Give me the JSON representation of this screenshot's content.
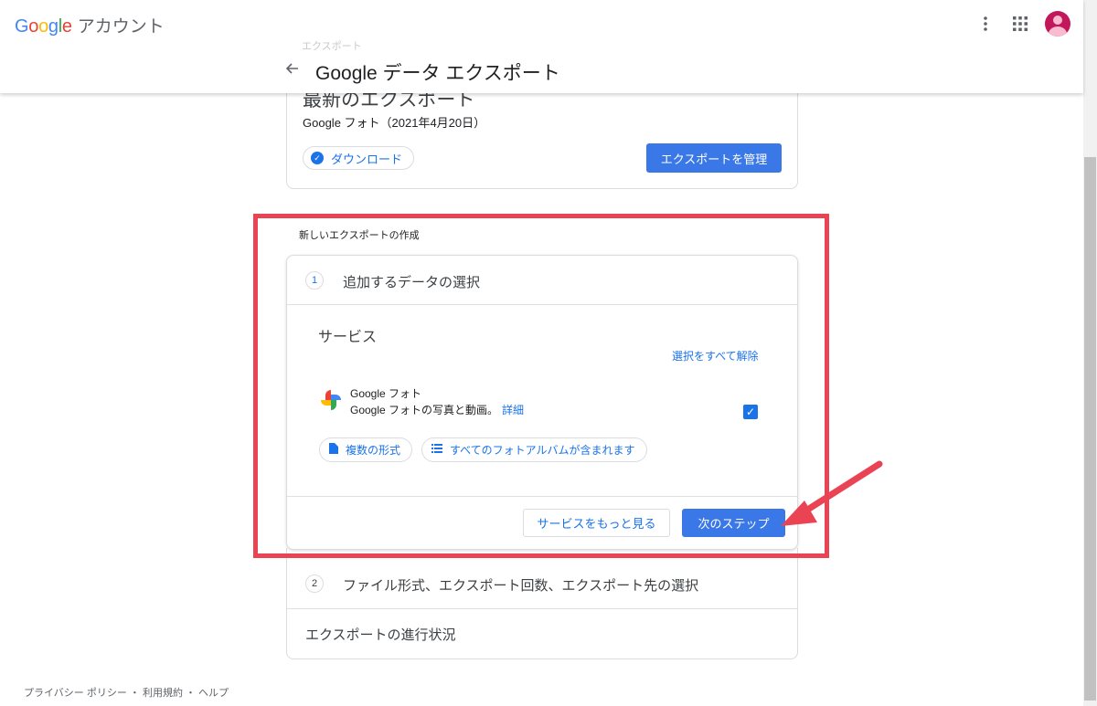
{
  "header": {
    "logo_word": "Google",
    "logo_suffix": "アカウント",
    "faded_label": "エクスポート",
    "page_title": "Google データ エクスポート",
    "icons": [
      "more-vert-icon",
      "apps-icon",
      "avatar",
      "arrow-back-icon"
    ]
  },
  "latest_export": {
    "heading": "最新のエクスポート",
    "meta": "Google フォト（2021年4月20日）",
    "download_label": "ダウンロード",
    "manage_button": "エクスポートを管理"
  },
  "new_export": {
    "section_label": "新しいエクスポートの作成",
    "step1": {
      "number": "1",
      "title": "追加するデータの選択",
      "services_heading": "サービス",
      "deselect_all": "選択をすべて解除",
      "service": {
        "name": "Google フォト",
        "description": "Google フォトの写真と動画。",
        "detail_link": "詳細",
        "checked": true,
        "format_chip": "複数の形式",
        "album_chip": "すべてのフォトアルバムが含まれます"
      },
      "more_services_button": "サービスをもっと見る",
      "next_step_button": "次のステップ"
    },
    "step2": {
      "number": "2",
      "title": "ファイル形式、エクスポート回数、エクスポート先の選択"
    },
    "progress_label": "エクスポートの進行状況"
  },
  "footer": {
    "text": "プライバシー ポリシー ・ 利用規約 ・ ヘルプ"
  },
  "colors": {
    "accent": "#1a73e8",
    "primary_button": "#3b78e7",
    "annotation": "#ea4454"
  }
}
